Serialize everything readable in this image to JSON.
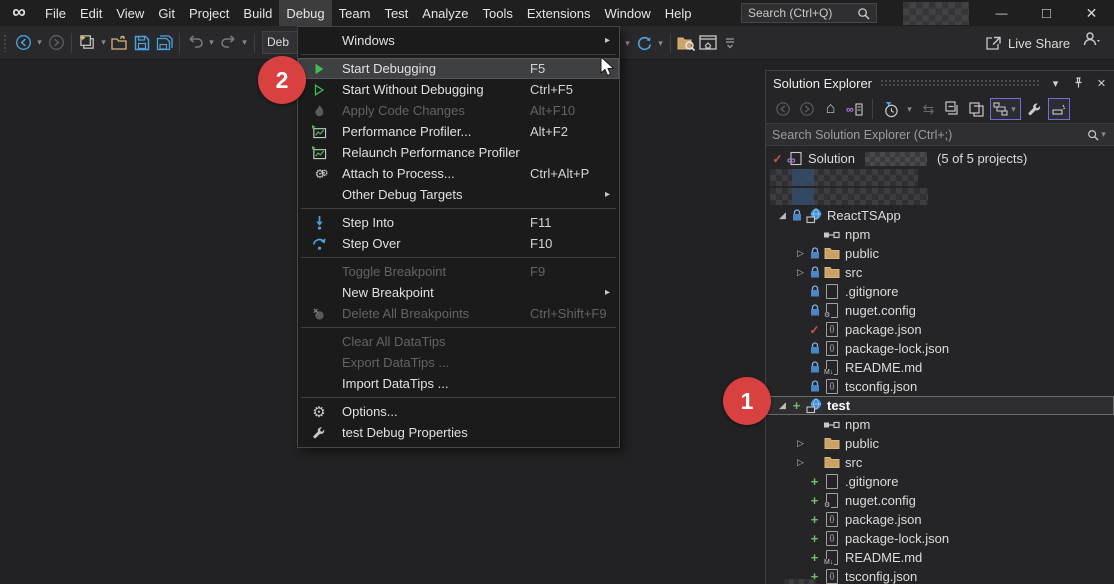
{
  "titlebar": {
    "menus": [
      "File",
      "Edit",
      "View",
      "Git",
      "Project",
      "Build",
      "Debug",
      "Team",
      "Test",
      "Analyze",
      "Tools",
      "Extensions",
      "Window",
      "Help"
    ],
    "active_menu": "Debug",
    "search_placeholder": "Search (Ctrl+Q)",
    "account": "redacted"
  },
  "toolbar": {
    "debug_target_partial": "Deb",
    "live_share_label": "Live Share"
  },
  "debug_menu": {
    "items": [
      {
        "label": "Windows",
        "shortcut": "",
        "submenu": true
      },
      {
        "label": "Start Debugging",
        "shortcut": "F5",
        "highlighted": true
      },
      {
        "label": "Start Without Debugging",
        "shortcut": "Ctrl+F5"
      },
      {
        "label": "Apply Code Changes",
        "shortcut": "Alt+F10",
        "disabled": true
      },
      {
        "label": "Performance Profiler...",
        "shortcut": "Alt+F2"
      },
      {
        "label": "Relaunch Performance Profiler",
        "shortcut": ""
      },
      {
        "label": "Attach to Process...",
        "shortcut": "Ctrl+Alt+P"
      },
      {
        "label": "Other Debug Targets",
        "shortcut": "",
        "submenu": true
      },
      {
        "label": "Step Into",
        "shortcut": "F11"
      },
      {
        "label": "Step Over",
        "shortcut": "F10"
      },
      {
        "label": "Toggle Breakpoint",
        "shortcut": "F9",
        "disabled": true
      },
      {
        "label": "New Breakpoint",
        "shortcut": "",
        "submenu": true
      },
      {
        "label": "Delete All Breakpoints",
        "shortcut": "Ctrl+Shift+F9",
        "disabled": true
      },
      {
        "label": "Clear All DataTips",
        "shortcut": "",
        "disabled": true
      },
      {
        "label": "Export DataTips ...",
        "shortcut": "",
        "disabled": true
      },
      {
        "label": "Import DataTips ...",
        "shortcut": ""
      },
      {
        "label": "Options...",
        "shortcut": ""
      },
      {
        "label": "test Debug Properties",
        "shortcut": ""
      }
    ]
  },
  "solution_explorer": {
    "title": "Solution Explorer",
    "search_placeholder": "Search Solution Explorer (Ctrl+;)",
    "tree": [
      {
        "label": "Solution",
        "suffix": "(5 of 5 projects)",
        "name_redacted": true
      },
      {
        "redacted": true
      },
      {
        "redacted": true
      },
      {
        "label": "ReactTSApp"
      },
      {
        "label": "npm"
      },
      {
        "label": "public"
      },
      {
        "label": "src"
      },
      {
        "label": ".gitignore"
      },
      {
        "label": "nuget.config"
      },
      {
        "label": "package.json"
      },
      {
        "label": "package-lock.json"
      },
      {
        "label": "README.md"
      },
      {
        "label": "tsconfig.json"
      },
      {
        "label": "test",
        "selected": true,
        "bold": true
      },
      {
        "label": "npm"
      },
      {
        "label": "public"
      },
      {
        "label": "src"
      },
      {
        "label": ".gitignore"
      },
      {
        "label": "nuget.config"
      },
      {
        "label": "package.json"
      },
      {
        "label": "package-lock.json"
      },
      {
        "label": "README.md"
      },
      {
        "label": "tsconfig.json"
      }
    ]
  },
  "annotations": {
    "step1": "1",
    "step2": "2"
  },
  "icons": {
    "expanded": "◢",
    "collapsed": "▷",
    "check": "✓",
    "plus": "+",
    "submenu": "▸",
    "caret_down": "▾",
    "overflow": "▿",
    "chevron_left": "‹",
    "chevron_right": "›",
    "home": "⌂",
    "sync": "⇆",
    "gear": "⚙",
    "infinity": "∞",
    "minimize": "—",
    "maximize": "□",
    "close": "✕",
    "json_glyph": "{}",
    "md_glyph": "M↓",
    "config_glyph": "⚙"
  },
  "colors": {
    "accent_red": "#d94040",
    "green": "#3fbf50",
    "blue": "#4aa3e0",
    "folder": "#dcb67a",
    "toggle_purple": "#6f6fd8",
    "lock_blue": "#4a86c5"
  }
}
